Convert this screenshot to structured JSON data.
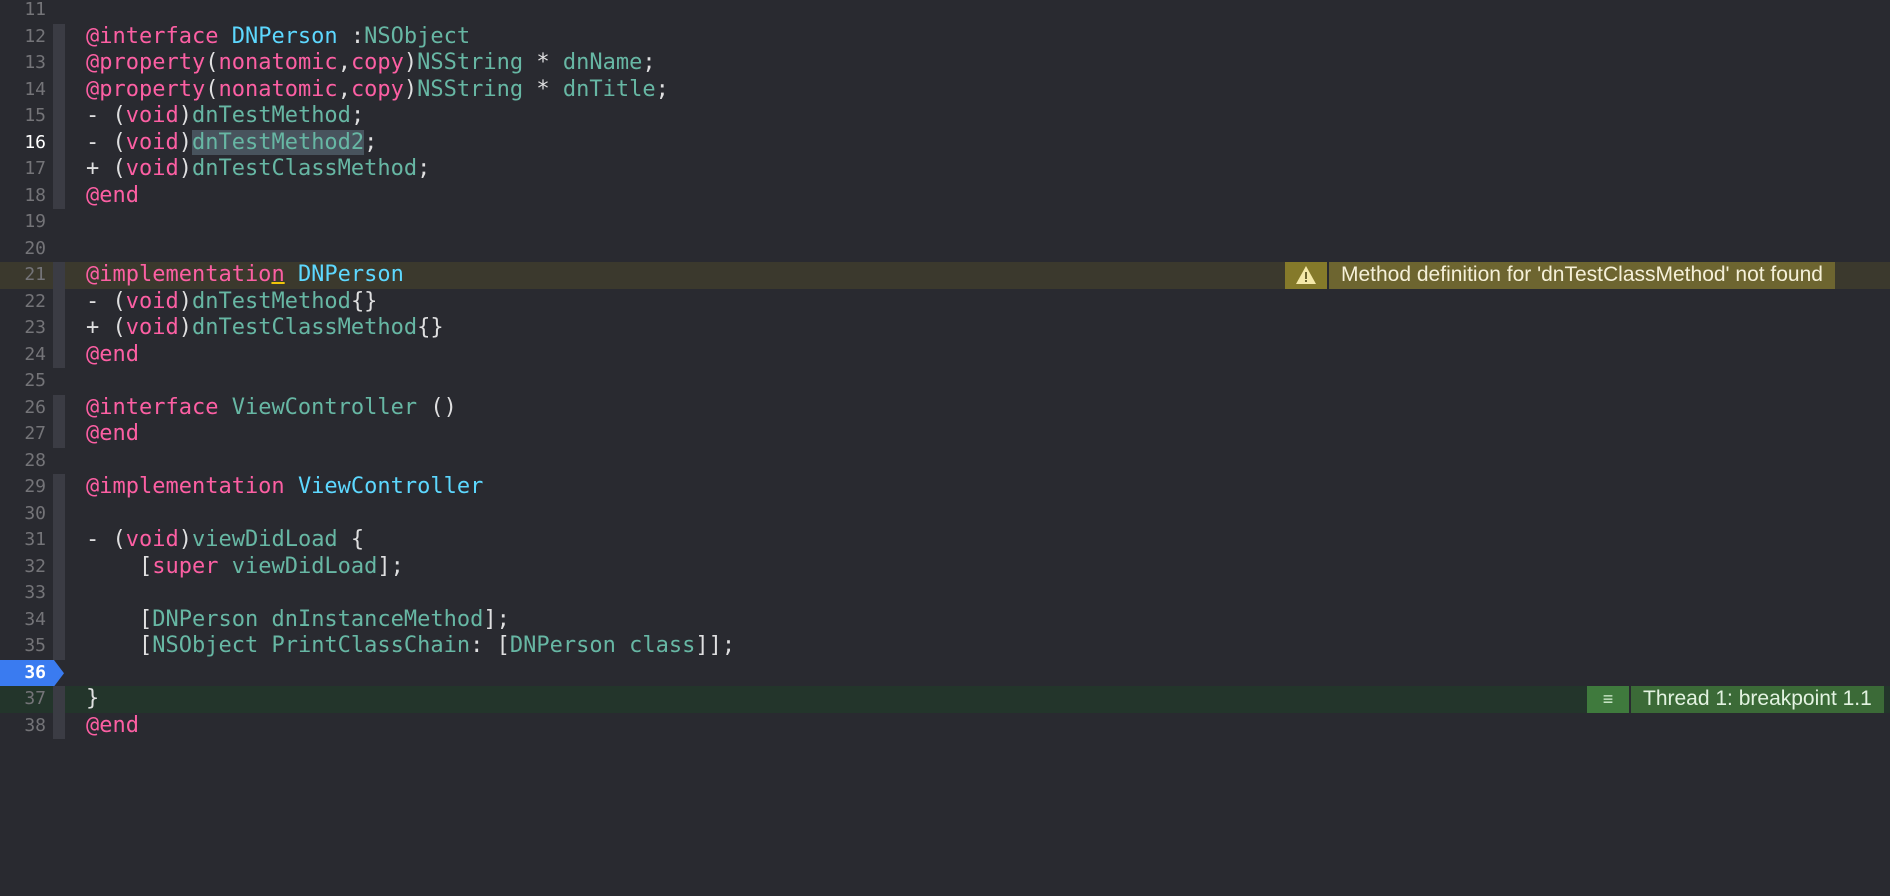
{
  "editor": {
    "lines": [
      {
        "num": "11",
        "tokens": []
      },
      {
        "num": "12",
        "tokens": [
          [
            "kw",
            "@interface"
          ],
          [
            "plain",
            " "
          ],
          [
            "cls",
            "DNPerson"
          ],
          [
            "plain",
            " :"
          ],
          [
            "type",
            "NSObject"
          ]
        ]
      },
      {
        "num": "13",
        "tokens": [
          [
            "kw",
            "@property"
          ],
          [
            "plain",
            "("
          ],
          [
            "kw",
            "nonatomic"
          ],
          [
            "plain",
            ","
          ],
          [
            "kw",
            "copy"
          ],
          [
            "plain",
            ")"
          ],
          [
            "type",
            "NSString"
          ],
          [
            "plain",
            " * "
          ],
          [
            "meth",
            "dnName"
          ],
          [
            "plain",
            ";"
          ]
        ]
      },
      {
        "num": "14",
        "tokens": [
          [
            "kw",
            "@property"
          ],
          [
            "plain",
            "("
          ],
          [
            "kw",
            "nonatomic"
          ],
          [
            "plain",
            ","
          ],
          [
            "kw",
            "copy"
          ],
          [
            "plain",
            ")"
          ],
          [
            "type",
            "NSString"
          ],
          [
            "plain",
            " * "
          ],
          [
            "meth",
            "dnTitle"
          ],
          [
            "plain",
            ";"
          ]
        ]
      },
      {
        "num": "15",
        "tokens": [
          [
            "plain",
            "- ("
          ],
          [
            "kw",
            "void"
          ],
          [
            "plain",
            ")"
          ],
          [
            "meth",
            "dnTestMethod"
          ],
          [
            "plain",
            ";"
          ]
        ]
      },
      {
        "num": "16",
        "current": true,
        "tokens": [
          [
            "plain",
            "- ("
          ],
          [
            "kw",
            "void"
          ],
          [
            "plain",
            ")"
          ],
          [
            "hlmeth",
            "dnTestMethod2"
          ],
          [
            "plain",
            ";"
          ]
        ]
      },
      {
        "num": "17",
        "tokens": [
          [
            "plain",
            "+ ("
          ],
          [
            "kw",
            "void"
          ],
          [
            "plain",
            ")"
          ],
          [
            "meth",
            "dnTestClassMethod"
          ],
          [
            "plain",
            ";"
          ]
        ]
      },
      {
        "num": "18",
        "tokens": [
          [
            "kw",
            "@end"
          ]
        ]
      },
      {
        "num": "19",
        "tokens": []
      },
      {
        "num": "20",
        "tokens": []
      },
      {
        "num": "21",
        "warning": true,
        "tokens": [
          [
            "kw",
            "@implementatio"
          ],
          [
            "kwwarn",
            "n"
          ],
          [
            "plain",
            " "
          ],
          [
            "cls",
            "DNPerson"
          ]
        ]
      },
      {
        "num": "22",
        "tokens": [
          [
            "plain",
            "- ("
          ],
          [
            "kw",
            "void"
          ],
          [
            "plain",
            ")"
          ],
          [
            "meth",
            "dnTestMethod"
          ],
          [
            "plain",
            "{}"
          ]
        ]
      },
      {
        "num": "23",
        "tokens": [
          [
            "plain",
            "+ ("
          ],
          [
            "kw",
            "void"
          ],
          [
            "plain",
            ")"
          ],
          [
            "meth",
            "dnTestClassMethod"
          ],
          [
            "plain",
            "{}"
          ]
        ]
      },
      {
        "num": "24",
        "tokens": [
          [
            "kw",
            "@end"
          ]
        ]
      },
      {
        "num": "25",
        "tokens": []
      },
      {
        "num": "26",
        "tokens": [
          [
            "kw",
            "@interface"
          ],
          [
            "plain",
            " "
          ],
          [
            "meth",
            "ViewController"
          ],
          [
            "plain",
            " ()"
          ]
        ]
      },
      {
        "num": "27",
        "tokens": [
          [
            "kw",
            "@end"
          ]
        ]
      },
      {
        "num": "28",
        "tokens": []
      },
      {
        "num": "29",
        "tokens": [
          [
            "kw",
            "@implementation"
          ],
          [
            "plain",
            " "
          ],
          [
            "cls",
            "ViewController"
          ]
        ]
      },
      {
        "num": "30",
        "tokens": []
      },
      {
        "num": "31",
        "tokens": [
          [
            "plain",
            "- ("
          ],
          [
            "kw",
            "void"
          ],
          [
            "plain",
            ")"
          ],
          [
            "meth",
            "viewDidLoad"
          ],
          [
            "plain",
            " {"
          ]
        ]
      },
      {
        "num": "32",
        "tokens": [
          [
            "plain",
            "    ["
          ],
          [
            "kw",
            "super"
          ],
          [
            "plain",
            " "
          ],
          [
            "meth",
            "viewDidLoad"
          ],
          [
            "plain",
            "];"
          ]
        ]
      },
      {
        "num": "33",
        "tokens": []
      },
      {
        "num": "34",
        "tokens": [
          [
            "plain",
            "    ["
          ],
          [
            "type",
            "DNPerson"
          ],
          [
            "plain",
            " "
          ],
          [
            "meth",
            "dnInstanceMethod"
          ],
          [
            "plain",
            "];"
          ]
        ]
      },
      {
        "num": "35",
        "tokens": [
          [
            "plain",
            "    ["
          ],
          [
            "type",
            "NSObject"
          ],
          [
            "plain",
            " "
          ],
          [
            "meth",
            "PrintClassChain"
          ],
          [
            "plain",
            ": ["
          ],
          [
            "type",
            "DNPerson"
          ],
          [
            "plain",
            " "
          ],
          [
            "meth",
            "class"
          ],
          [
            "plain",
            "]];"
          ]
        ]
      },
      {
        "num": "36",
        "breakpoint": true,
        "tokens": []
      },
      {
        "num": "37",
        "thread": true,
        "tokens": [
          [
            "plain",
            "}"
          ]
        ]
      },
      {
        "num": "38",
        "tokens": [
          [
            "kw",
            "@end"
          ]
        ]
      }
    ]
  },
  "warning_annotation": {
    "icon": "warning-triangle-icon",
    "text": "Method definition for 'dnTestClassMethod' not found"
  },
  "thread_annotation": {
    "icon": "thread-lines-icon",
    "text": "Thread 1: breakpoint 1.1"
  },
  "colors": {
    "background": "#292a30",
    "keyword": "#fc5fa3",
    "class_decl": "#5dd8ff",
    "type": "#67b7a4",
    "breakpoint": "#3a7bf0",
    "warning": "#857a2a",
    "thread": "#3f7a3d"
  }
}
